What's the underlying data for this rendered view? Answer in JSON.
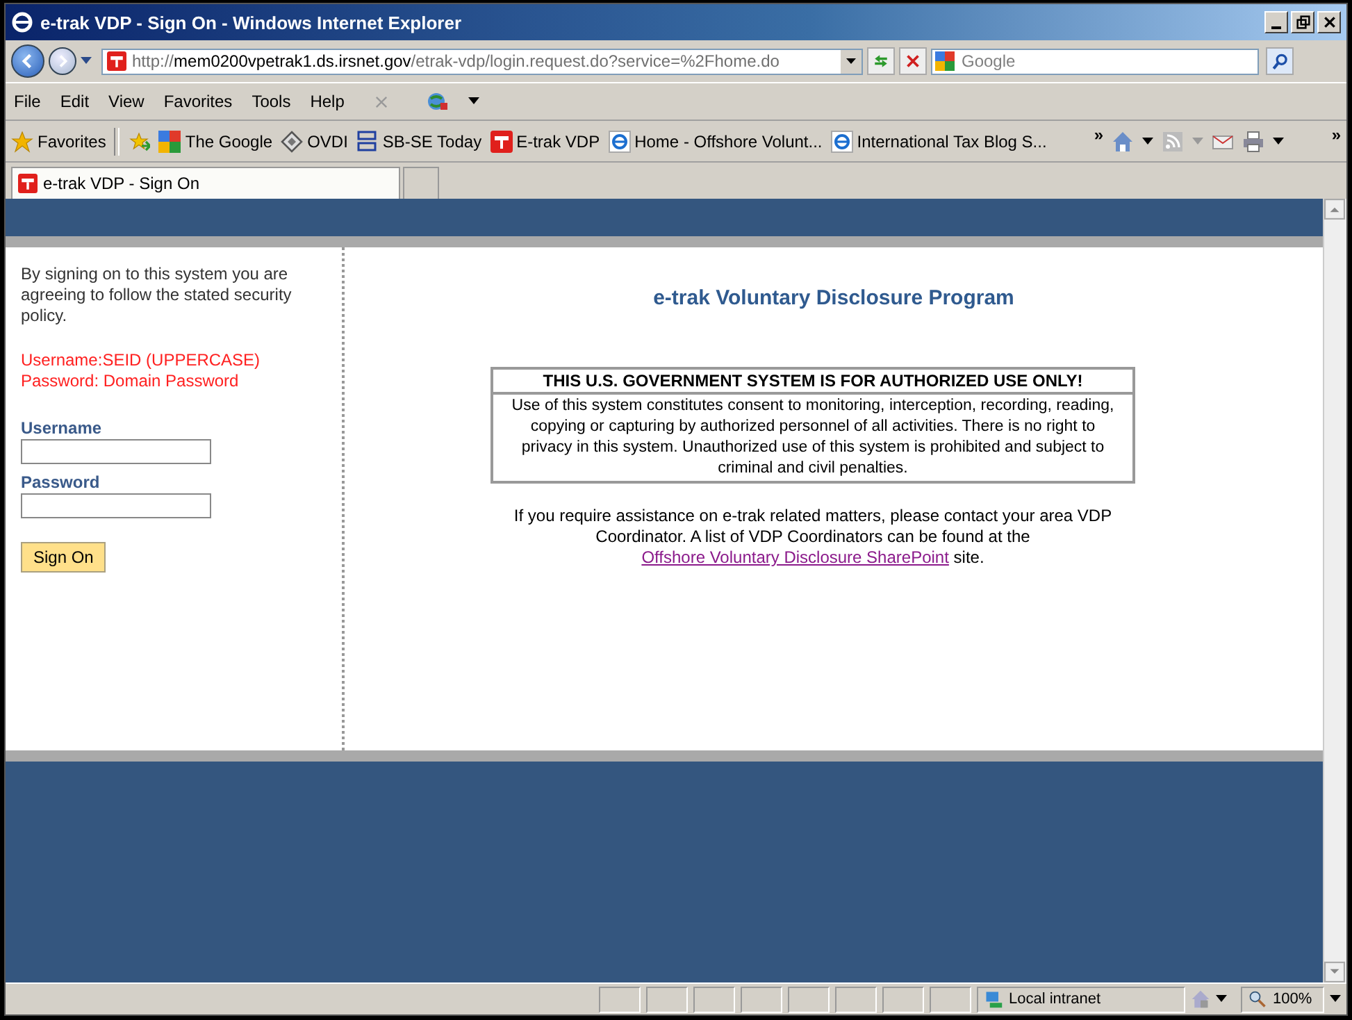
{
  "window": {
    "title": "e-trak VDP - Sign On - Windows Internet Explorer"
  },
  "address_bar": {
    "scheme": "http://",
    "host": "mem0200vpetrak1.ds.irsnet.gov",
    "path": "/etrak-vdp/login.request.do?service=%2Fhome.do"
  },
  "search": {
    "placeholder": "Google"
  },
  "menu": [
    "File",
    "Edit",
    "View",
    "Favorites",
    "Tools",
    "Help"
  ],
  "favorites_bar": {
    "label": "Favorites",
    "links": [
      {
        "label": "The Google",
        "kind": "google"
      },
      {
        "label": "OVDI",
        "kind": "diamond"
      },
      {
        "label": "SB-SE Today",
        "kind": "sbse"
      },
      {
        "label": "E-trak VDP",
        "kind": "etrak"
      },
      {
        "label": "Home - Offshore Volunt...",
        "kind": "ie"
      },
      {
        "label": "International Tax Blog S...",
        "kind": "ie"
      }
    ],
    "overflow": "»",
    "toolbar_overflow": "»"
  },
  "tabs": [
    {
      "label": "e-trak VDP - Sign On",
      "selected": true
    },
    {
      "selected": false
    }
  ],
  "sidebar": {
    "intro": "By signing on to this system you are agreeing to follow the stated security policy.",
    "hints": [
      "Username:SEID (UPPERCASE)",
      "Password: Domain Password"
    ],
    "fields": [
      {
        "label": "Username"
      },
      {
        "label": "Password"
      }
    ],
    "button": "Sign On"
  },
  "main": {
    "heading": "e-trak Voluntary Disclosure Program",
    "warning_title": "THIS U.S. GOVERNMENT SYSTEM IS FOR AUTHORIZED USE ONLY!",
    "warning_text": "Use of this system constitutes consent to monitoring, interception, recording, reading, copying or capturing by authorized personnel of all activities. There is no right to privacy in this system. Unauthorized use of this system is prohibited and subject to criminal and civil penalties.",
    "help_text": "If you require assistance on e-trak related matters, please contact your area VDP Coordinator. A list of VDP Coordinators can be found at the",
    "link": "Offshore Voluntary Disclosure SharePoint",
    "link_suffix": "site."
  },
  "status_bar": {
    "zone": "Local intranet",
    "zoom": "100%"
  }
}
